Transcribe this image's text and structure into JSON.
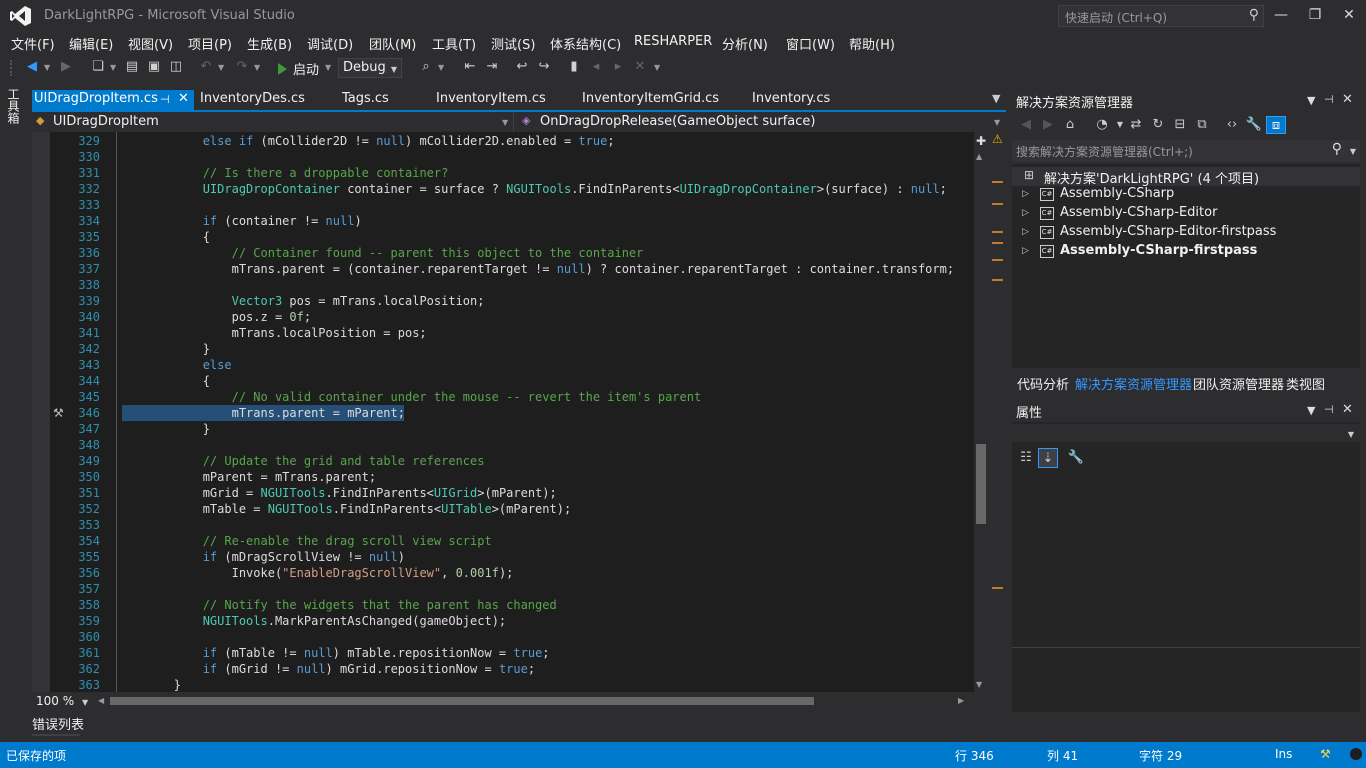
{
  "window": {
    "title": "DarkLightRPG - Microsoft Visual Studio",
    "quick_launch_placeholder": "快速启动 (Ctrl+Q)"
  },
  "menu": [
    "文件(F)",
    "编辑(E)",
    "视图(V)",
    "项目(P)",
    "生成(B)",
    "调试(D)",
    "团队(M)",
    "工具(T)",
    "测试(S)",
    "体系结构(C)",
    "RESHARPER",
    "分析(N)",
    "窗口(W)",
    "帮助(H)"
  ],
  "toolbar": {
    "start_label": "启动",
    "config_value": "Debug"
  },
  "left_strip": {
    "toolbox_label": "工具箱"
  },
  "tabs": [
    "UIDragDropItem.cs",
    "InventoryDes.cs",
    "Tags.cs",
    "InventoryItem.cs",
    "InventoryItemGrid.cs",
    "Inventory.cs"
  ],
  "navbar": {
    "class_name": "UIDragDropItem",
    "member_name": "OnDragDropRelease(GameObject surface)"
  },
  "editor": {
    "line_numbers": [
      "329",
      "330",
      "331",
      "332",
      "333",
      "334",
      "335",
      "336",
      "337",
      "338",
      "339",
      "340",
      "341",
      "342",
      "343",
      "344",
      "345",
      "346",
      "347",
      "348",
      "349",
      "350",
      "351",
      "352",
      "353",
      "354",
      "355",
      "356",
      "357",
      "358",
      "359",
      "360",
      "361",
      "362",
      "363"
    ],
    "lines": [
      "            else if (mCollider2D != null) mCollider2D.enabled = true;",
      "",
      "            // Is there a droppable container?",
      "            UIDragDropContainer container = surface ? NGUITools.FindInParents<UIDragDropContainer>(surface) : null;",
      "",
      "            if (container != null)",
      "            {",
      "                // Container found -- parent this object to the container",
      "                mTrans.parent = (container.reparentTarget != null) ? container.reparentTarget : container.transform;",
      "",
      "                Vector3 pos = mTrans.localPosition;",
      "                pos.z = 0f;",
      "                mTrans.localPosition = pos;",
      "            }",
      "            else",
      "            {",
      "                // No valid container under the mouse -- revert the item's parent",
      "                mTrans.parent = mParent;",
      "            }",
      "",
      "            // Update the grid and table references",
      "            mParent = mTrans.parent;",
      "            mGrid = NGUITools.FindInParents<UIGrid>(mParent);",
      "            mTable = NGUITools.FindInParents<UITable>(mParent);",
      "",
      "            // Re-enable the drag scroll view script",
      "            if (mDragScrollView != null)",
      "                Invoke(\"EnableDragScrollView\", 0.001f);",
      "",
      "            // Notify the widgets that the parent has changed",
      "            NGUITools.MarkParentAsChanged(gameObject);",
      "",
      "            if (mTable != null) mTable.repositionNow = true;",
      "            if (mGrid != null) mGrid.repositionNow = true;",
      "        }"
    ],
    "zoom": "100 %"
  },
  "error_list_label": "错误列表",
  "solution_explorer": {
    "title": "解决方案资源管理器",
    "search_placeholder": "搜索解决方案资源管理器(Ctrl+;)",
    "root": "解决方案'DarkLightRPG' (4 个项目)",
    "projects": [
      "Assembly-CSharp",
      "Assembly-CSharp-Editor",
      "Assembly-CSharp-Editor-firstpass",
      "Assembly-CSharp-firstpass"
    ],
    "bottom_tabs": [
      "代码分析",
      "解决方案资源管理器",
      "团队资源管理器",
      "类视图"
    ]
  },
  "properties": {
    "title": "属性"
  },
  "status": {
    "left": "已保存的项",
    "line": "行 346",
    "col": "列 41",
    "char": "字符 29",
    "mode": "Ins"
  },
  "colors": {
    "accent": "#007acc",
    "background": "#2d2d30",
    "editor_bg": "#1e1e1e"
  }
}
